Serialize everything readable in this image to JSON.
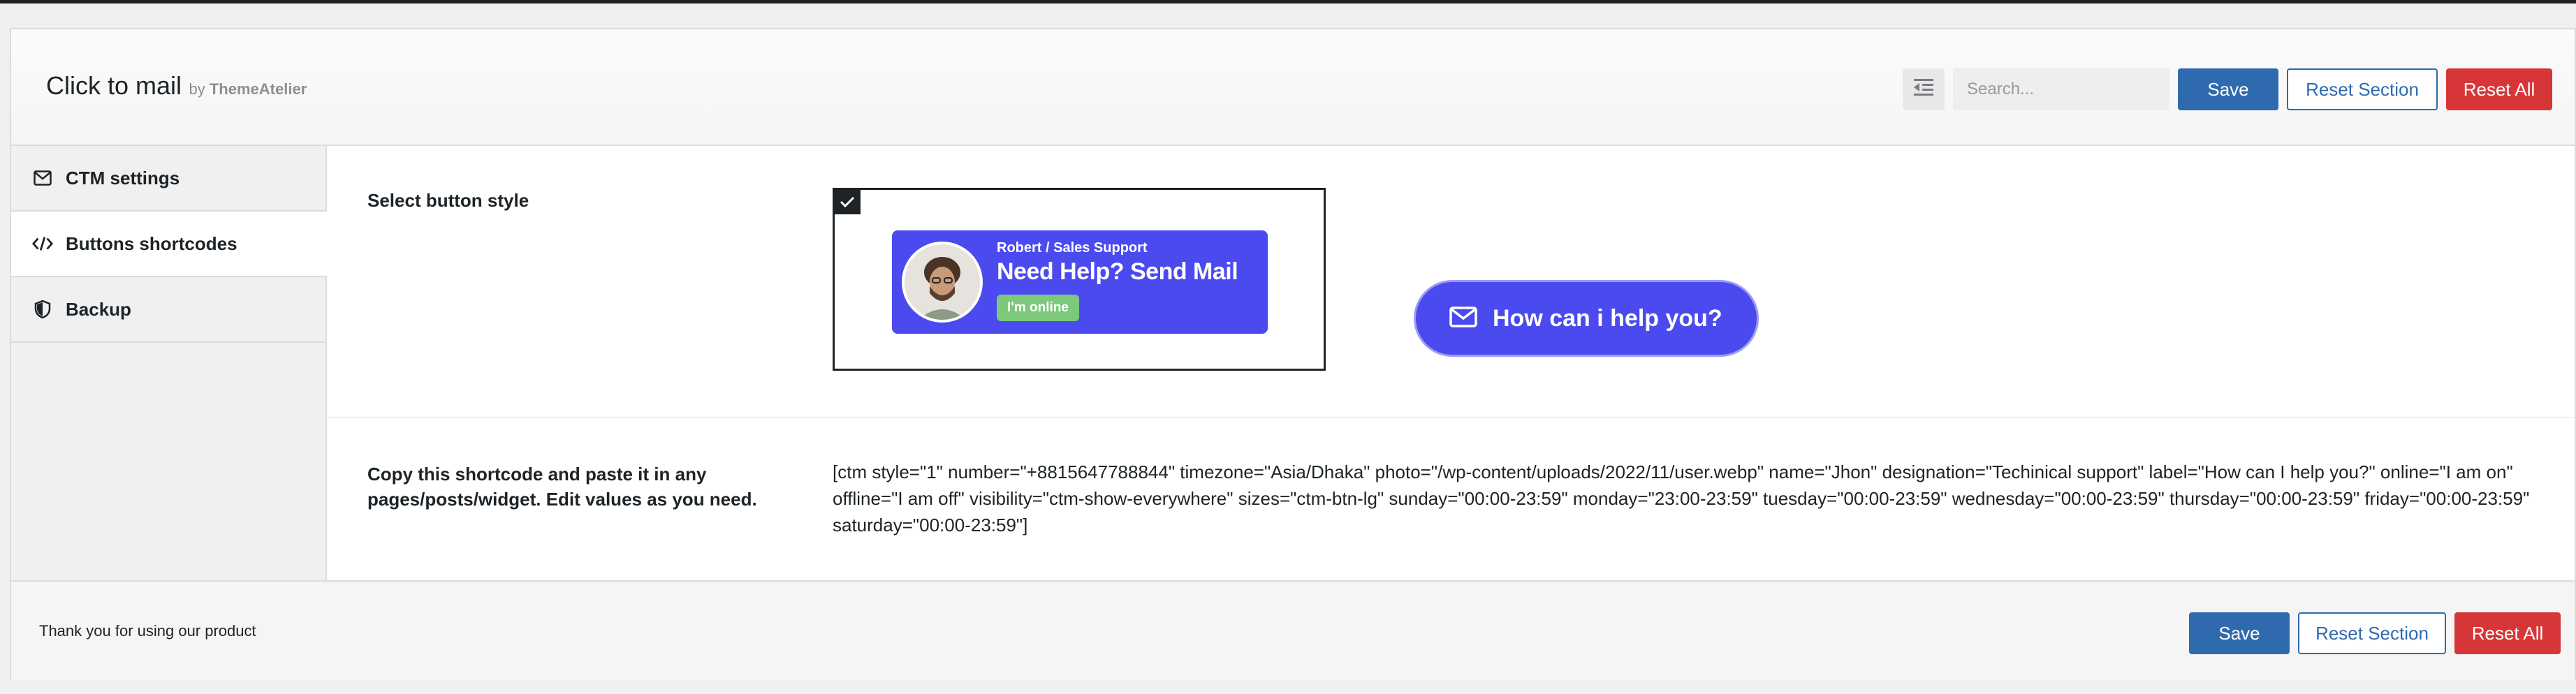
{
  "header": {
    "title": "Click to mail",
    "by_prefix": "by",
    "vendor": "ThemeAtelier",
    "search_placeholder": "Search...",
    "save_label": "Save",
    "reset_section_label": "Reset Section",
    "reset_all_label": "Reset All"
  },
  "sidebar": {
    "items": [
      {
        "label": "CTM settings",
        "icon": "envelope-icon",
        "active": false
      },
      {
        "label": "Buttons shortcodes",
        "icon": "code-icon",
        "active": true
      },
      {
        "label": "Backup",
        "icon": "shield-icon",
        "active": false
      }
    ]
  },
  "main": {
    "style_label": "Select button style",
    "selected_style": 1,
    "style1": {
      "designation": "Robert / Sales Support",
      "label": "Need Help? Send Mail",
      "online": "I'm online"
    },
    "style2": {
      "label": "How can i help you?"
    },
    "shortcode_label": "Copy this shortcode and paste it in any pages/posts/widget. Edit values as you need.",
    "shortcode": "[ctm style=\"1\" number=\"+8815647788844\" timezone=\"Asia/Dhaka\" photo=\"/wp-content/uploads/2022/11/user.webp\" name=\"Jhon\" designation=\"Techinical support\" label=\"How can I help you?\" online=\"I am on\" offline=\"I am off\" visibility=\"ctm-show-everywhere\" sizes=\"ctm-btn-lg\" sunday=\"00:00-23:59\" monday=\"23:00-23:59\" tuesday=\"00:00-23:59\" wednesday=\"00:00-23:59\" thursday=\"00:00-23:59\" friday=\"00:00-23:59\" saturday=\"00:00-23:59\"]"
  },
  "footer": {
    "text": "Thank you for using our product",
    "save_label": "Save",
    "reset_section_label": "Reset Section",
    "reset_all_label": "Reset All"
  },
  "colors": {
    "primary": "#2f6aaf",
    "danger": "#d63638",
    "button_style_bg": "#4b4aef",
    "online_badge": "#7cc97b"
  }
}
